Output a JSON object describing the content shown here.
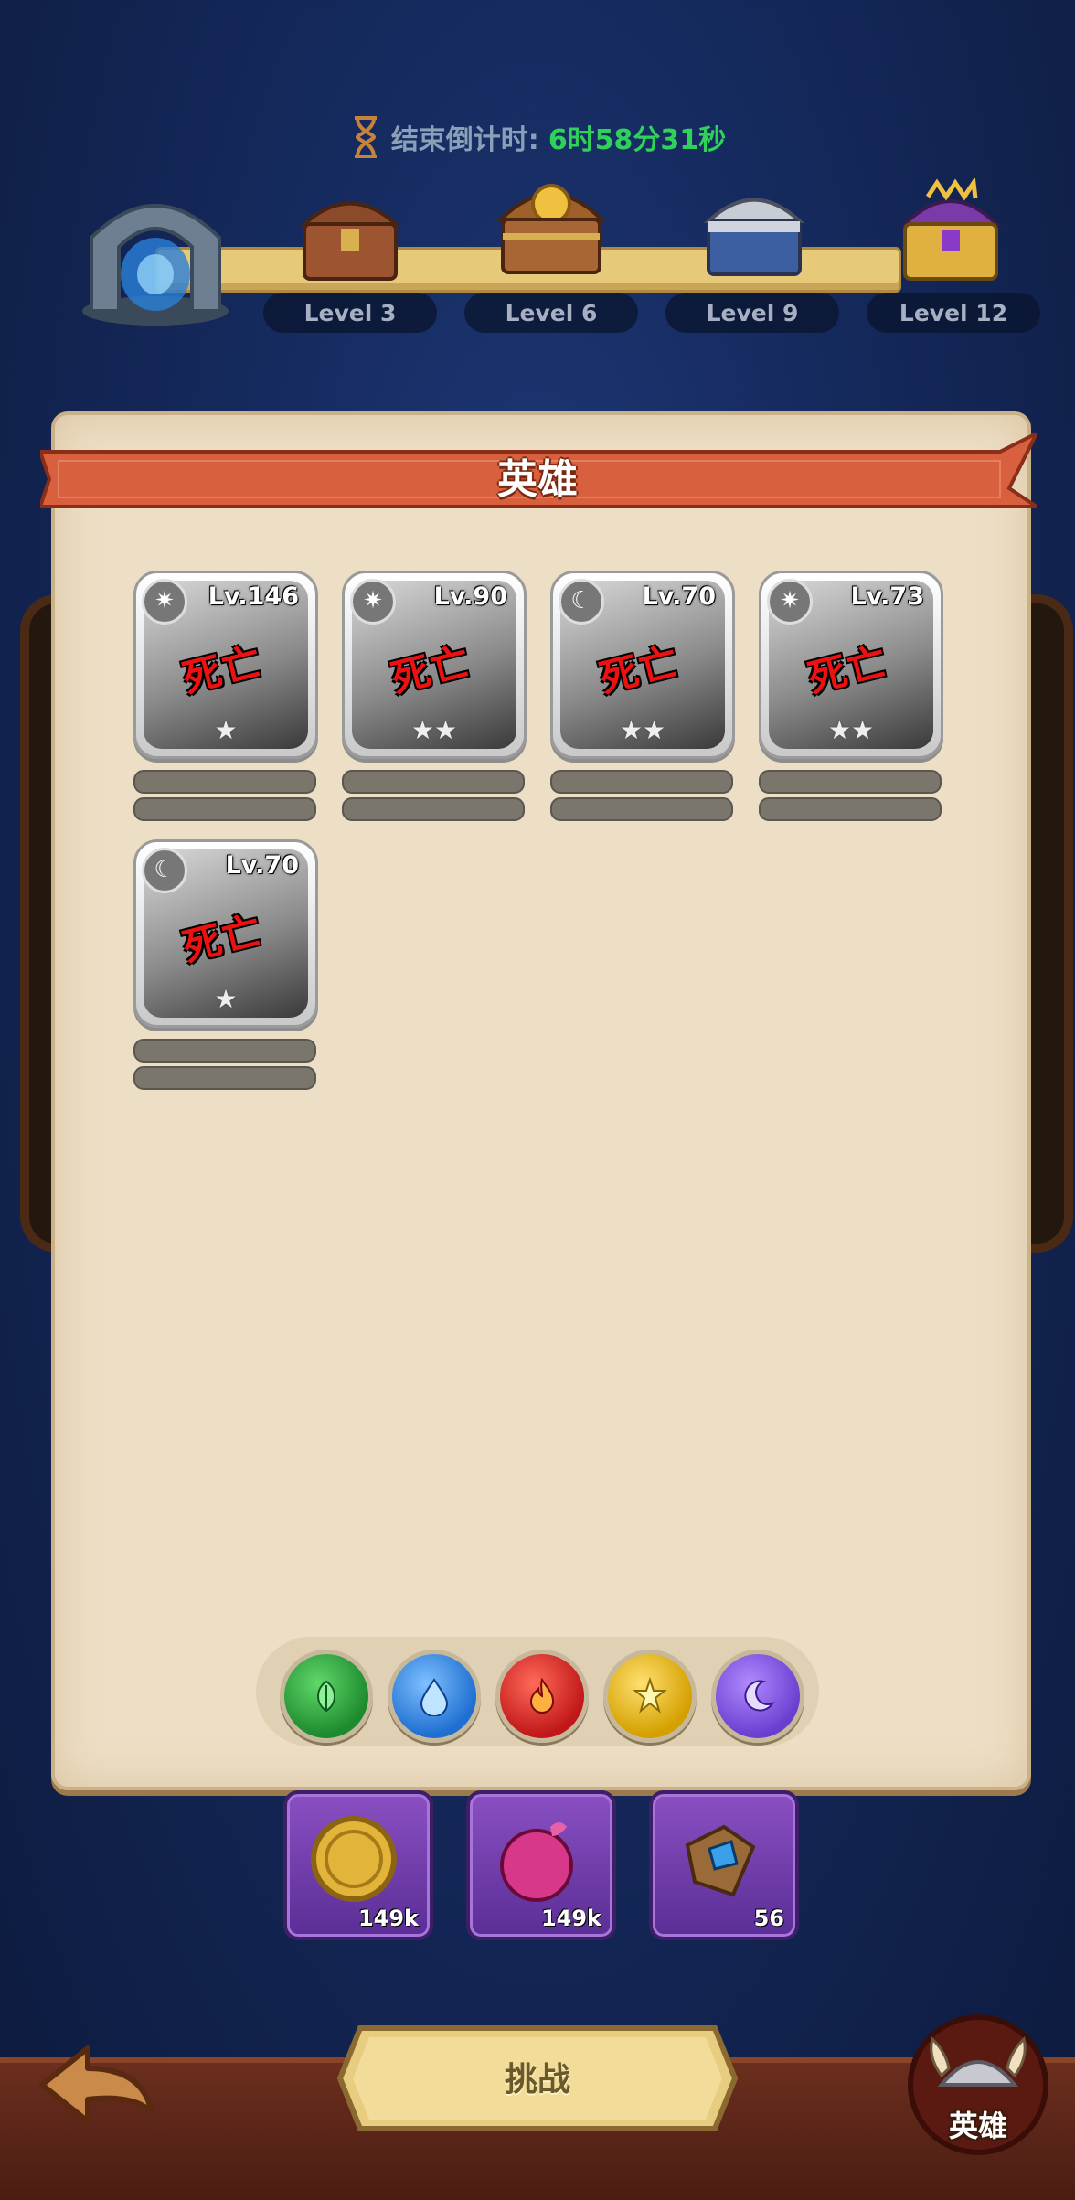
{
  "countdown": {
    "label": "结束倒计时:",
    "value": "6时58分31秒",
    "label_color": "#8aa0b8",
    "value_color": "#2fd15a"
  },
  "progress": {
    "rewards": [
      {
        "level_label": "Level 3",
        "icon": "wooden-chest-icon"
      },
      {
        "level_label": "Level 6",
        "icon": "gold-chest-icon"
      },
      {
        "level_label": "Level 9",
        "icon": "silver-chest-icon"
      },
      {
        "level_label": "Level 12",
        "icon": "purple-chest-icon"
      }
    ],
    "start_icon": "portal-icon"
  },
  "panel": {
    "title": "英雄",
    "banner_color": "#d9603e"
  },
  "heroes": [
    {
      "level": "Lv.146",
      "status": "死亡",
      "element": "light",
      "stars": "★"
    },
    {
      "level": "Lv.90",
      "status": "死亡",
      "element": "light",
      "stars": "★★"
    },
    {
      "level": "Lv.70",
      "status": "死亡",
      "element": "dark",
      "stars": "★★"
    },
    {
      "level": "Lv.73",
      "status": "死亡",
      "element": "light",
      "stars": "★★"
    },
    {
      "level": "Lv.70",
      "status": "死亡",
      "element": "dark",
      "stars": "★"
    }
  ],
  "element_filters": [
    {
      "name": "nature",
      "icon": "leaf-icon",
      "color": "#1e8a2e"
    },
    {
      "name": "water",
      "icon": "water-drop-icon",
      "color": "#1f6fd1"
    },
    {
      "name": "fire",
      "icon": "flame-icon",
      "color": "#c01818"
    },
    {
      "name": "light",
      "icon": "sun-icon",
      "color": "#d4a000"
    },
    {
      "name": "dark",
      "icon": "moon-icon",
      "color": "#6a3fd0"
    }
  ],
  "resources": [
    {
      "icon": "gold-coin-icon",
      "count": "149k"
    },
    {
      "icon": "pink-potion-icon",
      "count": "149k"
    },
    {
      "icon": "crystal-block-icon",
      "count": "56"
    }
  ],
  "buttons": {
    "challenge": "挑战",
    "hero": "英雄"
  }
}
